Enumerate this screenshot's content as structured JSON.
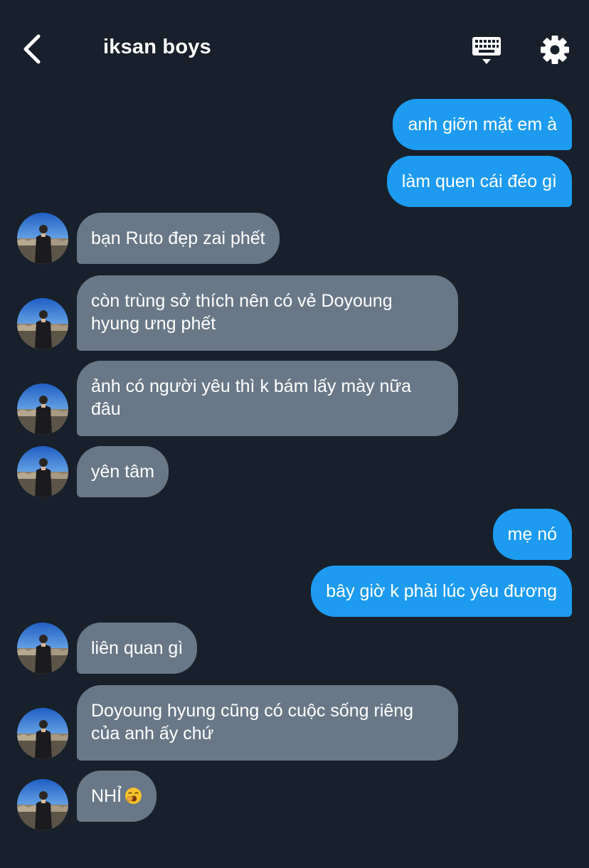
{
  "header": {
    "title": "iksan boys",
    "back_icon": "chevron-left-icon",
    "keyboard_icon": "keyboard-icon",
    "settings_icon": "gear-icon"
  },
  "colors": {
    "background": "#17202b",
    "sent_bubble": "#1d9bf0",
    "received_bubble": "#687888",
    "text": "#ffffff"
  },
  "messages": [
    {
      "from": "me",
      "text": "anh giỡn mặt em à"
    },
    {
      "from": "me",
      "text": "làm quen cái đéo gì"
    },
    {
      "from": "other",
      "text": "bạn Ruto đẹp zai phết"
    },
    {
      "from": "other",
      "text": "còn trùng sở thích nên có vẻ Doyoung hyung ưng phết"
    },
    {
      "from": "other",
      "text": "ảnh có người yêu thì k bám lấy mày nữa đâu"
    },
    {
      "from": "other",
      "text": "yên tâm"
    },
    {
      "from": "me",
      "text": "mẹ nó"
    },
    {
      "from": "me",
      "text": "bây giờ k phải lúc yêu đương"
    },
    {
      "from": "other",
      "text": "liên quan gì"
    },
    {
      "from": "other",
      "text": "Doyoung hyung cũng có cuộc sống riêng của anh ấy chứ"
    },
    {
      "from": "other",
      "text": "NHỈ",
      "emoji": "yawning-face-emoji"
    }
  ]
}
